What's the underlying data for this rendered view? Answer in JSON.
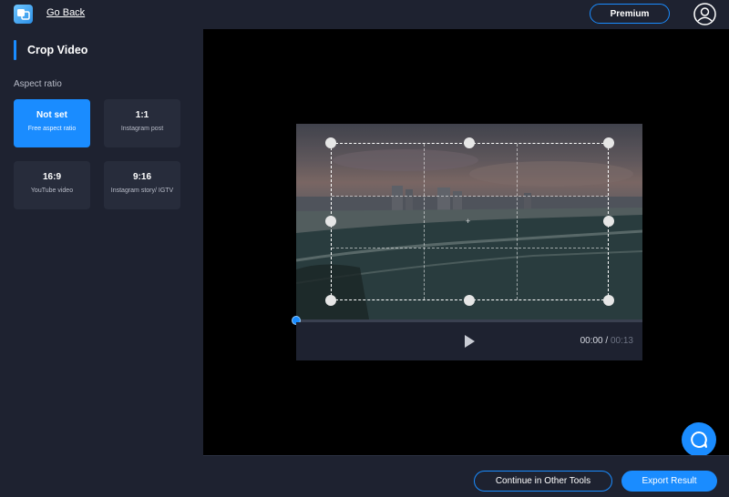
{
  "header": {
    "logo_icon": "video-tools-logo-icon",
    "back_label": "Go Back",
    "premium_label": "Premium",
    "user_icon": "user-avatar-icon"
  },
  "sidebar": {
    "title": "Crop Video",
    "section_label": "Aspect ratio",
    "ratios": [
      {
        "title": "Not set",
        "subtitle": "Free aspect ratio",
        "selected": true
      },
      {
        "title": "1:1",
        "subtitle": "Instagram post",
        "selected": false
      },
      {
        "title": "16:9",
        "subtitle": "YouTube video",
        "selected": false
      },
      {
        "title": "9:16",
        "subtitle": "Instagram story/ IGTV",
        "selected": false
      }
    ]
  },
  "player": {
    "current_time": "00:00",
    "separator": " / ",
    "duration": "00:13",
    "progress": 0
  },
  "footer": {
    "continue_label": "Continue in Other Tools",
    "export_label": "Export Result"
  },
  "colors": {
    "accent": "#1a8cff",
    "panel": "#1e2230",
    "card": "#272c3b",
    "canvas": "#000000"
  }
}
